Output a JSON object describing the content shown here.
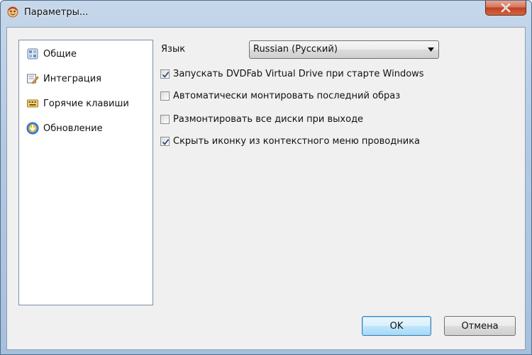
{
  "window": {
    "title": "Параметры..."
  },
  "nav": {
    "items": [
      {
        "label": "Общие",
        "icon": "general-settings-icon",
        "selected": true
      },
      {
        "label": "Интеграция",
        "icon": "integration-icon",
        "selected": false
      },
      {
        "label": "Горячие клавиши",
        "icon": "hotkeys-icon",
        "selected": false
      },
      {
        "label": "Обновление",
        "icon": "update-icon",
        "selected": false
      }
    ]
  },
  "general": {
    "language_label": "Язык",
    "language_value": "Russian (Русский)",
    "options": [
      {
        "label": "Запускать DVDFab Virtual Drive при старте Windows",
        "checked": true
      },
      {
        "label": "Автоматически монтировать последний образ",
        "checked": false
      },
      {
        "label": "Размонтировать все диски при выходе",
        "checked": false
      },
      {
        "label": "Скрыть иконку из контекстного меню проводника",
        "checked": true
      }
    ]
  },
  "buttons": {
    "ok_label": "OK",
    "cancel_label": "Отмена"
  },
  "colors": {
    "selection": "#3399ff",
    "close_button": "#c13f21",
    "dialog_background": "#f0f0f0"
  }
}
